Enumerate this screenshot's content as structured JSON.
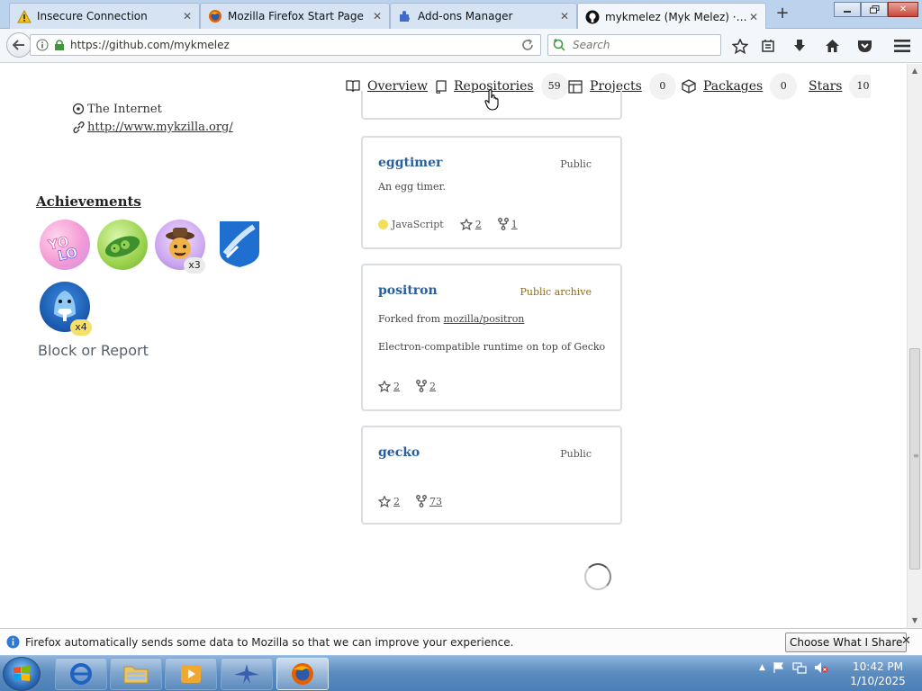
{
  "browser": {
    "tabs": [
      {
        "label": "Insecure Connection",
        "icon": "warning-icon"
      },
      {
        "label": "Mozilla Firefox Start Page",
        "icon": "firefox-icon"
      },
      {
        "label": "Add-ons Manager",
        "icon": "puzzle-icon"
      },
      {
        "label": "mykmelez (Myk Melez) · Gi...",
        "icon": "github-icon"
      }
    ],
    "url": "https://github.com/mykmelez",
    "search_placeholder": "Search"
  },
  "profile_nav": {
    "overview": "Overview",
    "repositories": "Repositories",
    "repositories_count": "59",
    "projects": "Projects",
    "projects_count": "0",
    "packages": "Packages",
    "packages_count": "0",
    "stars": "Stars",
    "stars_count": "10"
  },
  "sidebar": {
    "location": "The Internet",
    "website": "http://www.mykzilla.org/",
    "achievements_title": "Achievements",
    "badges": [
      {
        "name": "yolo",
        "count": ""
      },
      {
        "name": "pair-extraordinaire",
        "count": ""
      },
      {
        "name": "quickdraw",
        "count": "x3"
      },
      {
        "name": "arctic-code-vault",
        "count": ""
      },
      {
        "name": "pull-shark",
        "count": "x4"
      }
    ],
    "block_report": "Block or Report"
  },
  "repos": [
    {
      "name": "eggtimer",
      "visibility": "Public",
      "description": "An egg timer.",
      "language": "JavaScript",
      "stars": "2",
      "forks": "1"
    },
    {
      "name": "positron",
      "visibility": "Public archive",
      "forked_prefix": "Forked from",
      "forked_from": "mozilla/positron",
      "description": "Electron-compatible runtime on top of Gecko",
      "stars": "2",
      "forks": "2"
    },
    {
      "name": "gecko",
      "visibility": "Public",
      "stars": "2",
      "forks": "73"
    }
  ],
  "notification": {
    "message": "Firefox automatically sends some data to Mozilla so that we can improve your experience.",
    "button": "Choose What I Share"
  },
  "taskbar": {
    "time": "10:42 PM",
    "date": "1/10/2025"
  }
}
